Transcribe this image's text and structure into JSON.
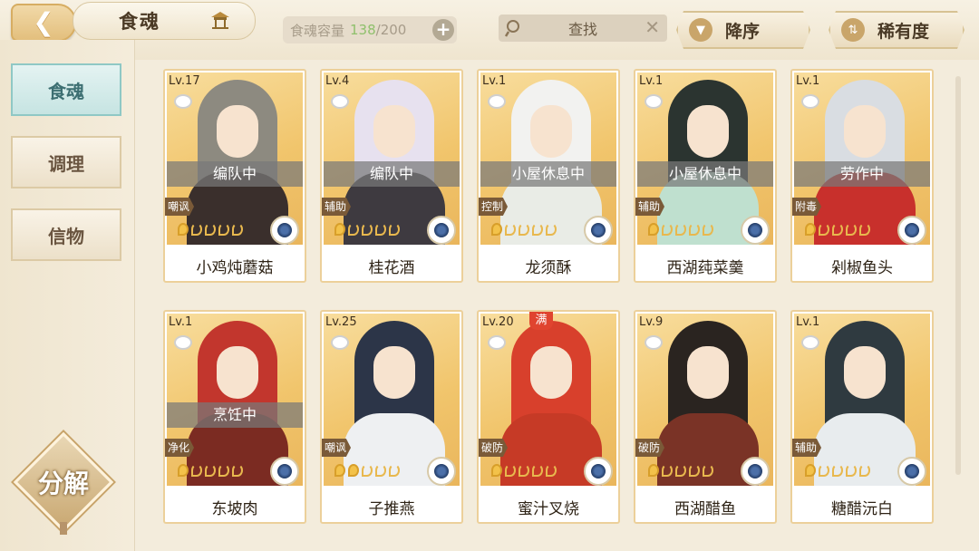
{
  "header": {
    "title": "食魂",
    "capacity_label": "食魂容量",
    "capacity_current": "138",
    "capacity_max": "/200",
    "search_label": "查找",
    "sort_label": "降序",
    "rarity_label": "稀有度"
  },
  "sidebar": {
    "tabs": [
      {
        "label": "食魂",
        "active": true
      },
      {
        "label": "调理",
        "active": false
      },
      {
        "label": "信物",
        "active": false
      }
    ],
    "decompose_label": "分解"
  },
  "cards": [
    {
      "level": "Lv.17",
      "status": "编队中",
      "role": "嘲讽",
      "stars": 1,
      "name": "小鸡炖蘑菇",
      "hair": "#8d8a80",
      "outfit": "#3a2f2c"
    },
    {
      "level": "Lv.4",
      "status": "编队中",
      "role": "辅助",
      "stars": 1,
      "name": "桂花酒",
      "hair": "#e7e1ef",
      "outfit": "#3e3a40"
    },
    {
      "level": "Lv.1",
      "status": "小屋休息中",
      "role": "控制",
      "stars": 1,
      "name": "龙须酥",
      "hair": "#f2f2f0",
      "outfit": "#e9ece6"
    },
    {
      "level": "Lv.1",
      "status": "小屋休息中",
      "role": "辅助",
      "stars": 1,
      "name": "西湖莼菜羹",
      "hair": "#2b3430",
      "outfit": "#bfe0cf"
    },
    {
      "level": "Lv.1",
      "status": "劳作中",
      "role": "附毒",
      "stars": 1,
      "name": "剁椒鱼头",
      "hair": "#d9dde2",
      "outfit": "#c8302c"
    },
    {
      "level": "Lv.1",
      "status": "烹饪中",
      "role": "净化",
      "stars": 1,
      "name": "东坡肉",
      "hair": "#c2362d",
      "outfit": "#7b2b22"
    },
    {
      "level": "Lv.25",
      "status": "",
      "role": "嘲讽",
      "stars": 2,
      "name": "子推燕",
      "hair": "#2c3548",
      "outfit": "#eef0f2"
    },
    {
      "level": "Lv.20",
      "status": "",
      "role": "破防",
      "stars": 1,
      "name": "蜜汁叉烧",
      "hair": "#d8402c",
      "outfit": "#c63a26",
      "badge": "满"
    },
    {
      "level": "Lv.9",
      "status": "",
      "role": "破防",
      "stars": 1,
      "name": "西湖醋鱼",
      "hair": "#2a2420",
      "outfit": "#7a3326"
    },
    {
      "level": "Lv.1",
      "status": "",
      "role": "辅助",
      "stars": 1,
      "name": "糖醋沅白",
      "hair": "#2f3a40",
      "outfit": "#e8ecee"
    }
  ]
}
